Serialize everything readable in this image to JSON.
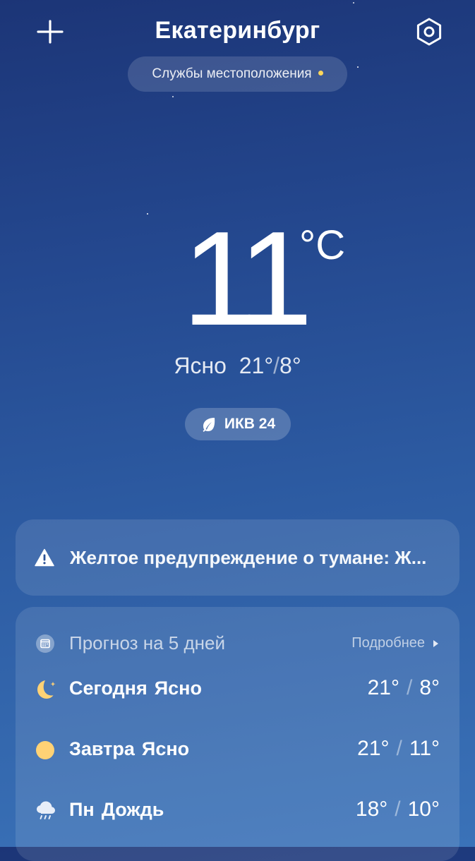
{
  "header": {
    "city": "Екатеринбург",
    "location_services_label": "Службы местоположения",
    "add_icon": "plus-icon",
    "settings_icon": "hexagon-gear-icon"
  },
  "current": {
    "temperature": "11",
    "unit": "°C",
    "condition": "Ясно",
    "high": "21°",
    "low": "8°",
    "separator": "/",
    "aqi_label": "ИКВ 24",
    "aqi_icon": "leaf-icon"
  },
  "alert": {
    "icon": "warning-triangle-icon",
    "text": "Желтое предупреждение о тумане: Ж..."
  },
  "forecast": {
    "icon": "calendar-icon",
    "title": "Прогноз на 5 дней",
    "more_label": "Подробнее",
    "days": [
      {
        "day": "Сегодня",
        "condition": "Ясно",
        "high": "21°",
        "low": "8°",
        "icon": "moon-icon"
      },
      {
        "day": "Завтра",
        "condition": "Ясно",
        "high": "21°",
        "low": "11°",
        "icon": "sun-icon"
      },
      {
        "day": "Пн",
        "condition": "Дождь",
        "high": "18°",
        "low": "10°",
        "icon": "rain-cloud-icon"
      }
    ],
    "separator": "/"
  },
  "colors": {
    "background_top": "#1c3577",
    "background_bottom": "#3a72b8",
    "accent_yellow": "#ffd65a"
  }
}
